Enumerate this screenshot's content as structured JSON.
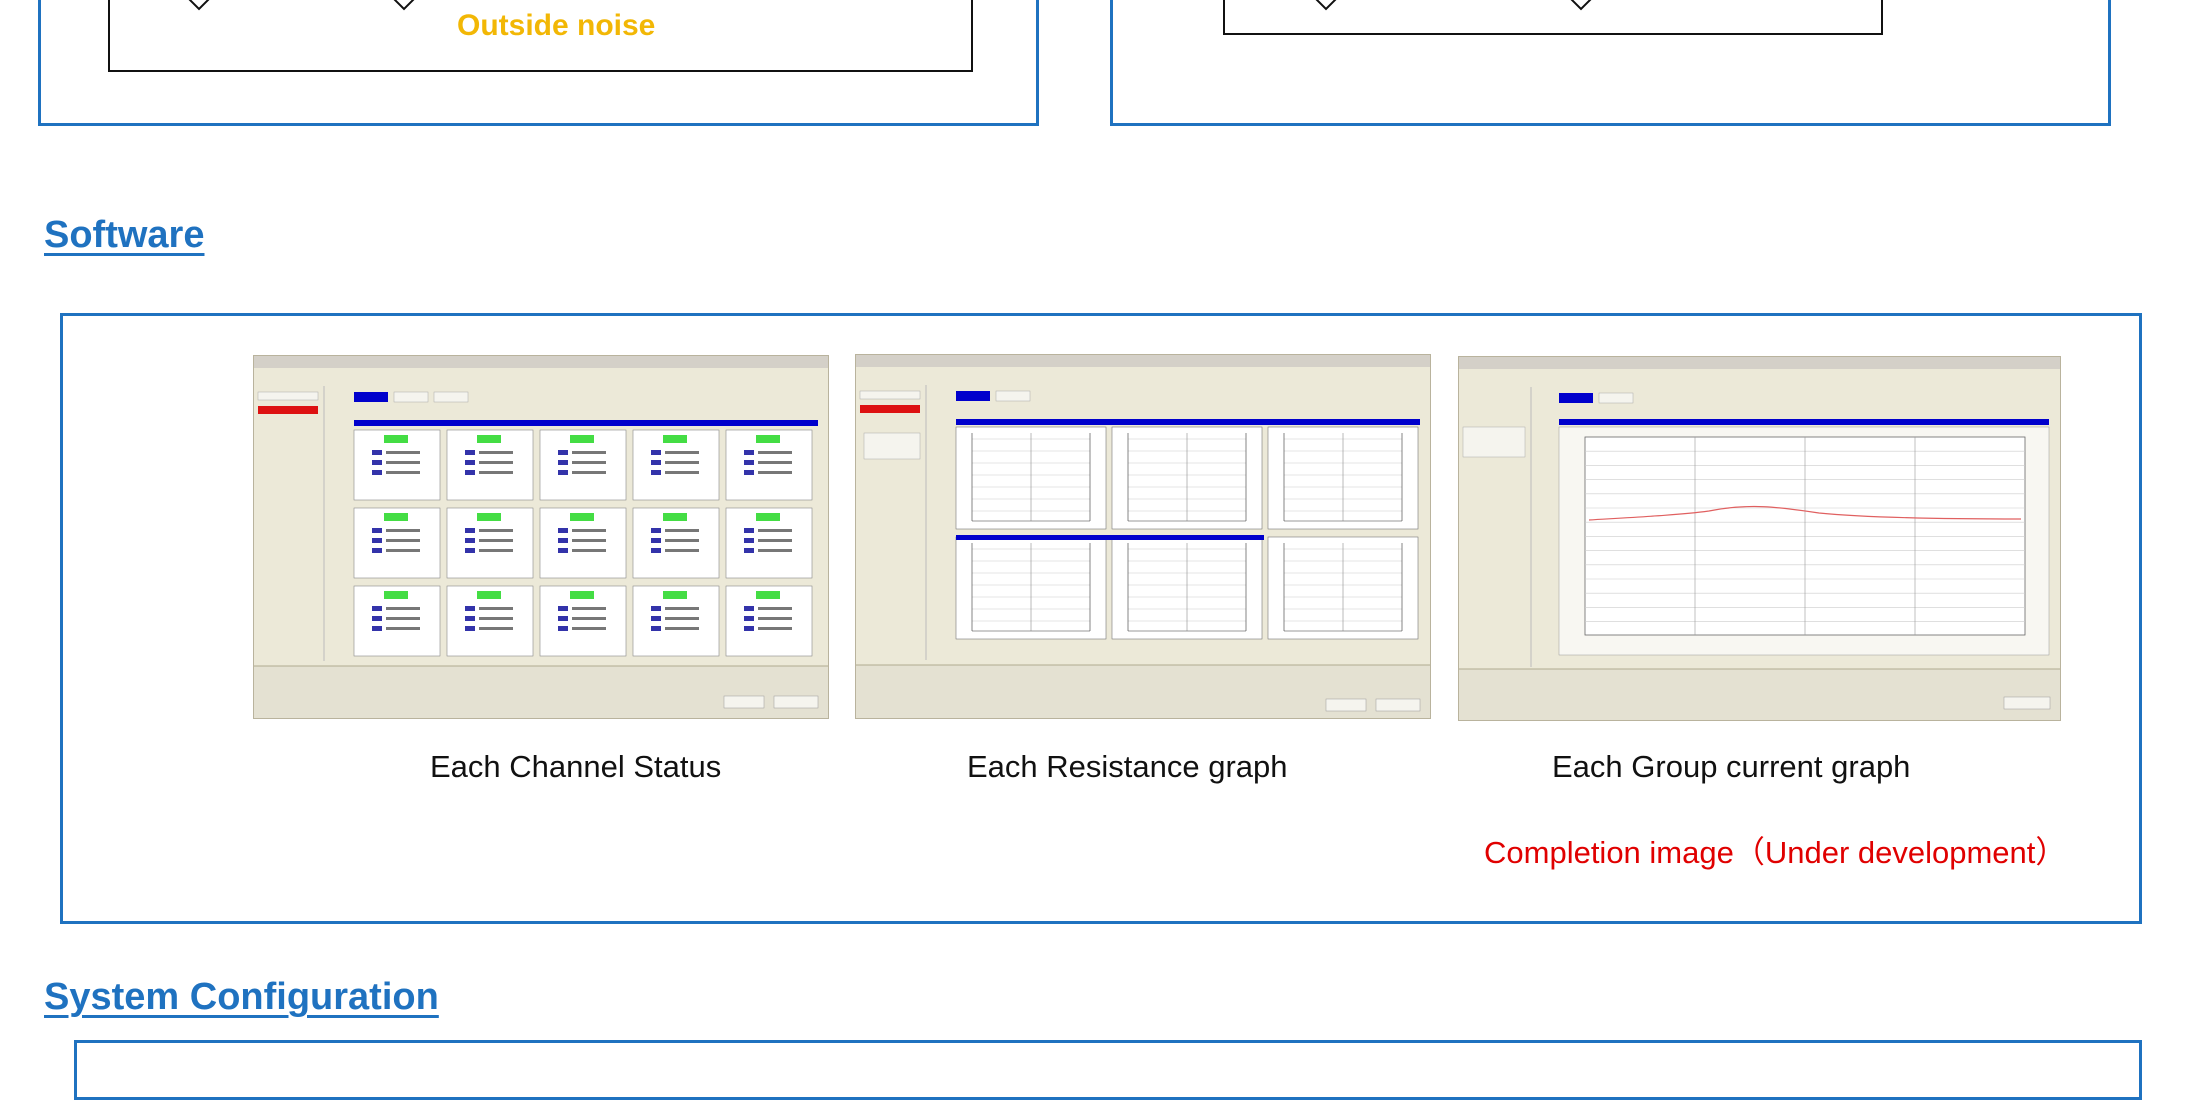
{
  "top_diagram": {
    "noise_label": "Outside noise"
  },
  "software": {
    "heading": "Software",
    "screenshots": [
      {
        "caption": "Each Channel Status"
      },
      {
        "caption": "Each Resistance graph"
      },
      {
        "caption": "Each Group current graph"
      }
    ],
    "note": "Completion image（Under development）"
  },
  "system_configuration": {
    "heading": "System Configuration"
  },
  "colors": {
    "frame_blue": "#1f72c0",
    "noise_label": "#f2b705",
    "note_red": "#e00000",
    "screenshot_bg": "#ece9d8",
    "panel_header_blue": "#0000cc",
    "status_green": "#44dd44",
    "status_red": "#dd1111"
  }
}
